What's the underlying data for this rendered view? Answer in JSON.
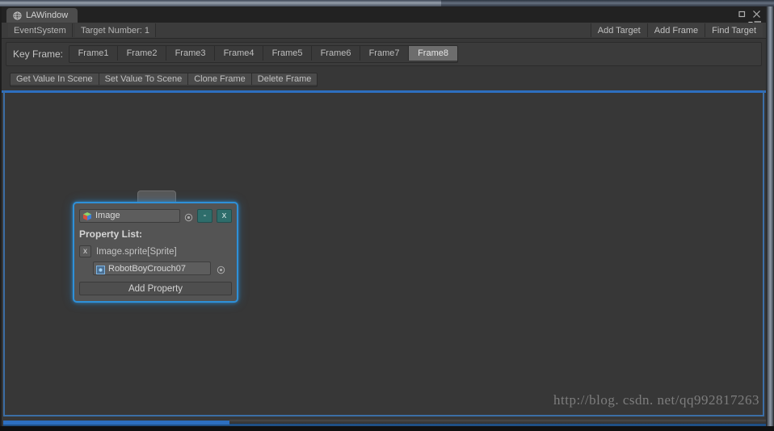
{
  "window": {
    "tab_title": "LAWindow",
    "tab_icon": "globe-icon",
    "maximize_icon": "maximize-icon",
    "close_icon": "close-icon",
    "menu_icon": "panel-menu-icon"
  },
  "info_bar": {
    "event_system": "EventSystem",
    "target_number": "Target Number: 1",
    "buttons": [
      {
        "label": "Add Target"
      },
      {
        "label": "Add Frame"
      },
      {
        "label": "Find Target"
      }
    ]
  },
  "key_frame": {
    "label": "Key Frame:",
    "frames": [
      {
        "label": "Frame1",
        "selected": false
      },
      {
        "label": "Frame2",
        "selected": false
      },
      {
        "label": "Frame3",
        "selected": false
      },
      {
        "label": "Frame4",
        "selected": false
      },
      {
        "label": "Frame5",
        "selected": false
      },
      {
        "label": "Frame6",
        "selected": false
      },
      {
        "label": "Frame7",
        "selected": false
      },
      {
        "label": "Frame8",
        "selected": true
      }
    ],
    "selected_frame": "Frame8"
  },
  "actions": [
    {
      "label": "Get Value In Scene"
    },
    {
      "label": "Set Value To Scene"
    },
    {
      "label": "Clone Frame"
    },
    {
      "label": "Delete Frame"
    }
  ],
  "node_panel": {
    "object_field": {
      "value": "Image",
      "icon": "prefab-cube-icon",
      "picker_icon": "object-picker-icon"
    },
    "minimize_label": "-",
    "close_label": "x",
    "property_list_title": "Property List:",
    "properties": [
      {
        "remove_label": "x",
        "name": "Image.sprite[Sprite]",
        "value": "RobotBoyCrouch07",
        "value_icon": "sprite-icon",
        "picker_icon": "object-picker-icon"
      }
    ],
    "add_property_label": "Add Property"
  },
  "watermark": "http://blog. csdn. net/qq992817263",
  "colors": {
    "background": "#373737",
    "panel_glow": "#2e90d8",
    "teal_button": "#2e6d6b",
    "selected_tab": "#6d6d6d",
    "status_blue": "#2d6fc0"
  }
}
